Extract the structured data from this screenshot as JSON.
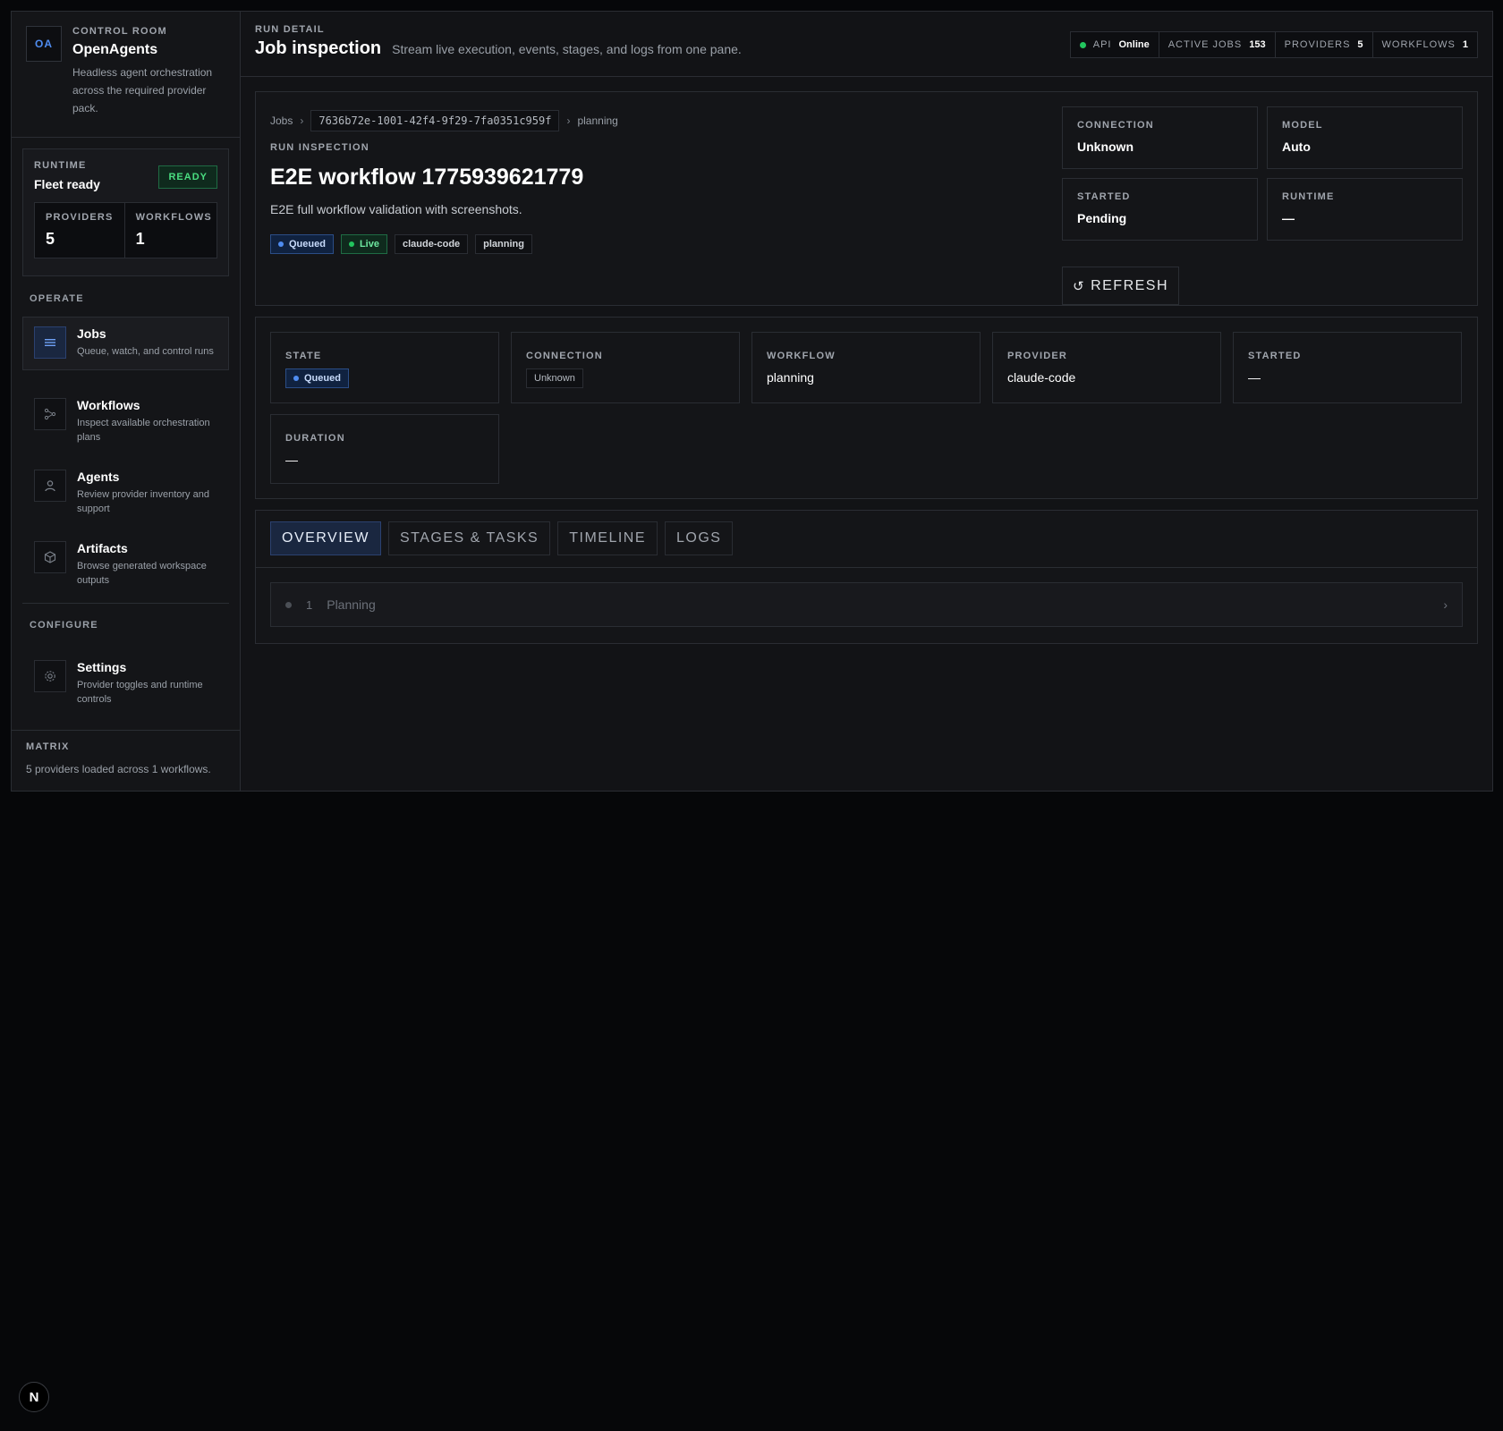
{
  "sidebar": {
    "brand": {
      "logo": "OA",
      "eyebrow": "CONTROL ROOM",
      "title": "OpenAgents",
      "description": "Headless agent orchestration across the required provider pack."
    },
    "runtime": {
      "eyebrow": "RUNTIME",
      "title": "Fleet ready",
      "badge": "READY",
      "stats": [
        {
          "label": "PROVIDERS",
          "value": "5"
        },
        {
          "label": "WORKFLOWS",
          "value": "1"
        }
      ]
    },
    "operate_label": "OPERATE",
    "nav": [
      {
        "title": "Jobs",
        "desc": "Queue, watch, and control runs",
        "icon": "list-icon"
      },
      {
        "title": "Workflows",
        "desc": "Inspect available orchestration plans",
        "icon": "workflow-icon"
      },
      {
        "title": "Agents",
        "desc": "Review provider inventory and support",
        "icon": "user-icon"
      },
      {
        "title": "Artifacts",
        "desc": "Browse generated workspace outputs",
        "icon": "box-icon"
      }
    ],
    "configure_label": "CONFIGURE",
    "settings": {
      "title": "Settings",
      "desc": "Provider toggles and runtime controls",
      "icon": "gear-icon"
    },
    "matrix": {
      "label": "MATRIX",
      "text": "5 providers loaded across 1 workflows."
    }
  },
  "topbar": {
    "eyebrow": "RUN DETAIL",
    "title": "Job inspection",
    "subtitle": "Stream live execution, events, stages, and logs from one pane.",
    "status": {
      "api_label": "API",
      "api_value": "Online",
      "active_jobs_label": "ACTIVE JOBS",
      "active_jobs_value": "153",
      "providers_label": "PROVIDERS",
      "providers_value": "5",
      "workflows_label": "WORKFLOWS",
      "workflows_value": "1"
    }
  },
  "run": {
    "breadcrumb": {
      "root": "Jobs",
      "sep": "›",
      "id": "7636b72e-1001-42f4-9f29-7fa0351c959f",
      "leaf": "planning"
    },
    "eyebrow": "RUN INSPECTION",
    "title": "E2E workflow 1775939621779",
    "description": "E2E full workflow validation with screenshots.",
    "tags": {
      "state": "Queued",
      "live": "Live",
      "provider": "claude-code",
      "workflow": "planning"
    },
    "meta": {
      "connection_label": "CONNECTION",
      "connection_value": "Unknown",
      "model_label": "MODEL",
      "model_value": "Auto",
      "started_label": "STARTED",
      "started_value": "Pending",
      "runtime_label": "RUNTIME",
      "runtime_value": "—"
    },
    "refresh_label": "REFRESH"
  },
  "facts": {
    "state_label": "STATE",
    "state_value": "Queued",
    "connection_label": "CONNECTION",
    "connection_value": "Unknown",
    "workflow_label": "WORKFLOW",
    "workflow_value": "planning",
    "provider_label": "PROVIDER",
    "provider_value": "claude-code",
    "started_label": "STARTED",
    "started_value": "—",
    "duration_label": "DURATION",
    "duration_value": "—"
  },
  "tabs": [
    "OVERVIEW",
    "STAGES & TASKS",
    "TIMELINE",
    "LOGS"
  ],
  "stages": [
    {
      "num": "1",
      "name": "Planning"
    }
  ],
  "next_badge": "N",
  "colors": {
    "accent": "#4f8cf0",
    "success": "#22c55e",
    "background": "#060709",
    "panel": "#141518"
  }
}
